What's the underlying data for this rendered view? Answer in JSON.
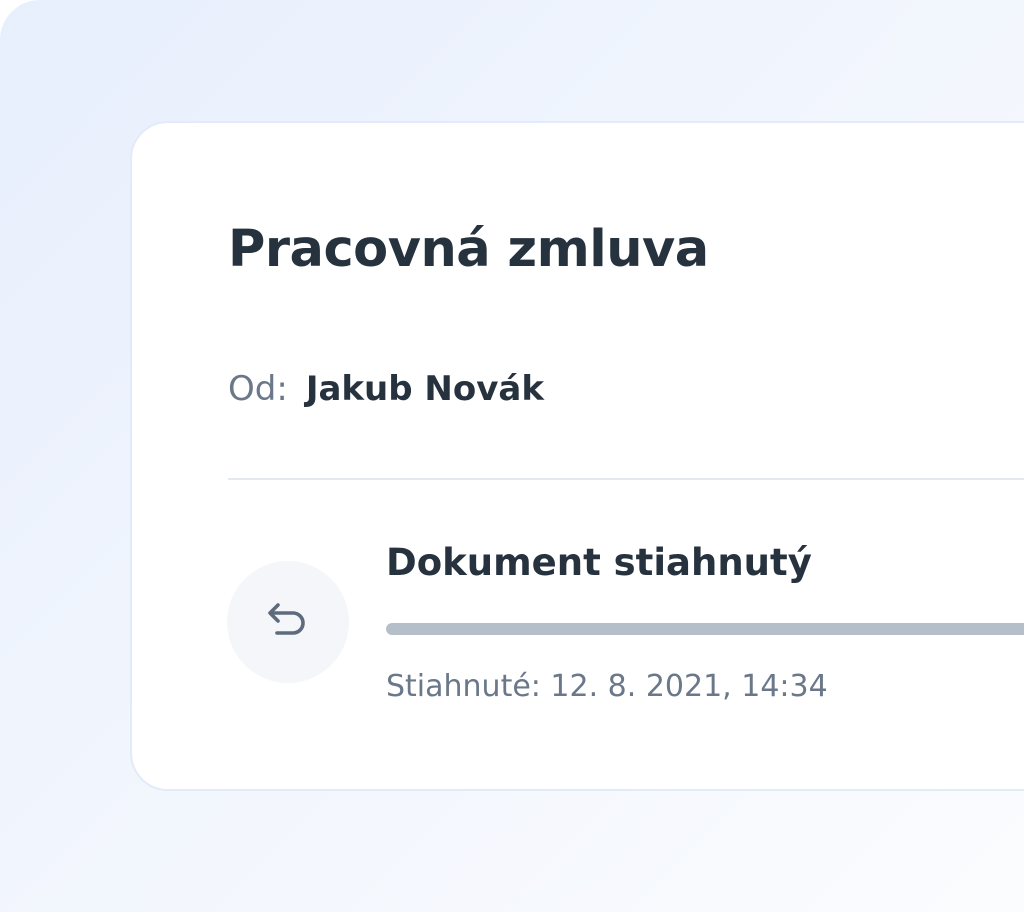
{
  "document": {
    "title": "Pracovná zmluva",
    "from_label": "Od:",
    "from_name": "Jakub Novák"
  },
  "status": {
    "icon": "undo-arrow-icon",
    "title": "Dokument stiahnutý",
    "progress": 1.0,
    "timestamp": "Stiahnuté: 12. 8. 2021, 14:34"
  },
  "colors": {
    "background_gradient_start": "#e7effd",
    "card": "#ffffff",
    "text_primary": "#27323f",
    "text_secondary": "#6a7889",
    "progress_fill": "#b5bfca",
    "icon_circle": "#f4f6fa"
  }
}
